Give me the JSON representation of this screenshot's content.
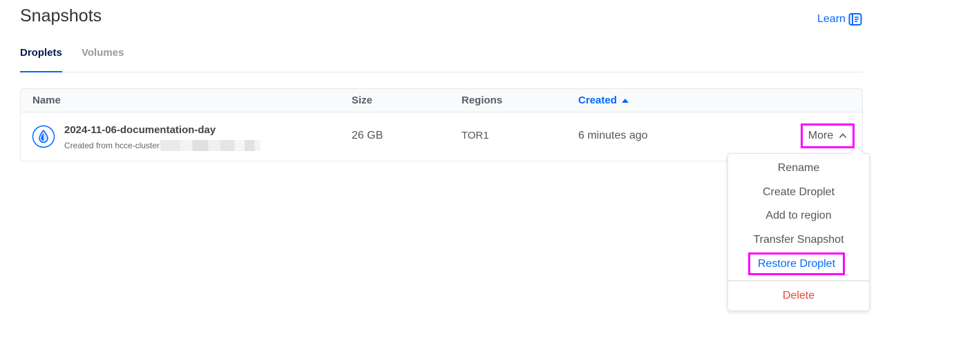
{
  "header": {
    "title": "Snapshots",
    "learn_label": "Learn"
  },
  "tabs": [
    {
      "label": "Droplets",
      "active": true
    },
    {
      "label": "Volumes",
      "active": false
    }
  ],
  "table": {
    "columns": {
      "name": "Name",
      "size": "Size",
      "regions": "Regions",
      "created": "Created"
    },
    "sort": {
      "column": "created",
      "direction": "ascending"
    },
    "rows": [
      {
        "name": "2024-11-06-documentation-day",
        "created_from": "Created from hcce-cluster",
        "size": "26 GB",
        "region": "TOR1",
        "created": "6 minutes ago",
        "more_label": "More"
      }
    ]
  },
  "menu": {
    "items": [
      {
        "label": "Rename"
      },
      {
        "label": "Create Droplet"
      },
      {
        "label": "Add to region"
      },
      {
        "label": "Transfer Snapshot"
      },
      {
        "label": "Restore Droplet",
        "highlighted": true
      }
    ],
    "danger_item": {
      "label": "Delete"
    }
  },
  "colors": {
    "accent": "#0069ff",
    "highlight_box": "#ff00ff",
    "danger": "#e8453c"
  },
  "icons": {
    "learn": "document-icon",
    "row": "droplet-icon",
    "more": "chevron-up-icon",
    "sort": "sort-ascending-icon"
  }
}
